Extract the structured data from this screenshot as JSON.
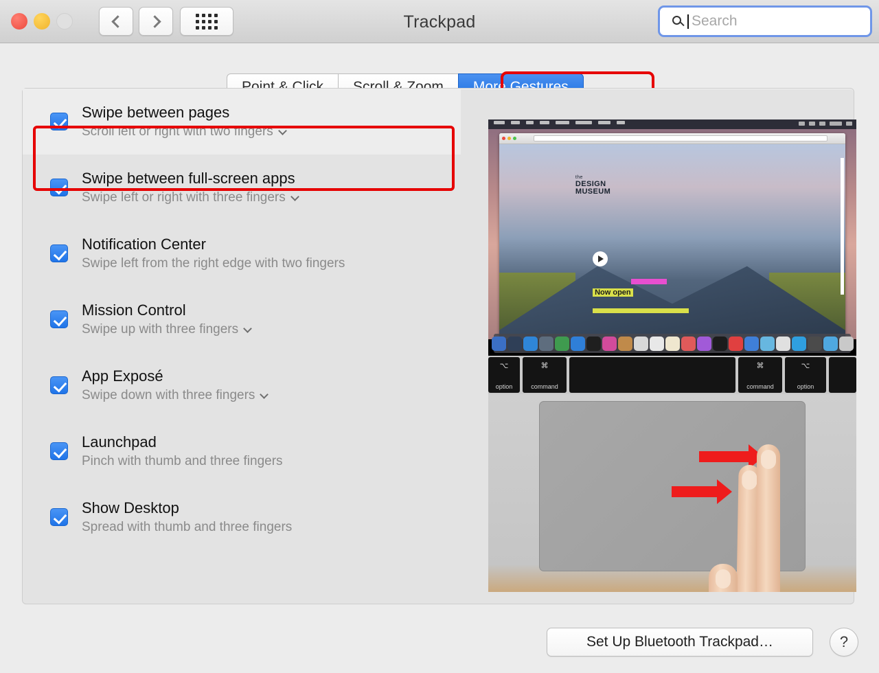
{
  "window": {
    "title": "Trackpad",
    "traffic_lights": [
      "close",
      "minimize",
      "zoom"
    ],
    "nav_back": "back-arrow",
    "nav_forward": "forward-arrow",
    "show_all": "grid-icon"
  },
  "search": {
    "placeholder": "Search",
    "value": "",
    "icon": "search-icon",
    "focused": true
  },
  "tabs": [
    {
      "label": "Point & Click",
      "selected": false
    },
    {
      "label": "Scroll & Zoom",
      "selected": false
    },
    {
      "label": "More Gestures",
      "selected": true
    }
  ],
  "gestures": [
    {
      "title": "Swipe between pages",
      "subtitle": "Scroll left or right with two fingers",
      "checked": true,
      "has_dropdown": true,
      "selected": true
    },
    {
      "title": "Swipe between full-screen apps",
      "subtitle": "Swipe left or right with three fingers",
      "checked": true,
      "has_dropdown": true,
      "selected": false
    },
    {
      "title": "Notification Center",
      "subtitle": "Swipe left from the right edge with two fingers",
      "checked": true,
      "has_dropdown": false,
      "selected": false
    },
    {
      "title": "Mission Control",
      "subtitle": "Swipe up with three fingers",
      "checked": true,
      "has_dropdown": true,
      "selected": false
    },
    {
      "title": "App Exposé",
      "subtitle": "Swipe down with three fingers",
      "checked": true,
      "has_dropdown": true,
      "selected": false
    },
    {
      "title": "Launchpad",
      "subtitle": "Pinch with thumb and three fingers",
      "checked": true,
      "has_dropdown": false,
      "selected": false
    },
    {
      "title": "Show Desktop",
      "subtitle": "Spread with thumb and three fingers",
      "checked": true,
      "has_dropdown": false,
      "selected": false
    }
  ],
  "preview": {
    "site_title_small": "the",
    "site_title_line1": "DESIGN",
    "site_title_line2": "MUSEUM",
    "banner_text": "Now open",
    "play_icon": "play-icon",
    "keys": [
      {
        "label": "option",
        "glyph": "⌥"
      },
      {
        "label": "command",
        "glyph": "⌘"
      },
      {
        "label": "",
        "glyph": ""
      },
      {
        "label": "command",
        "glyph": "⌘"
      },
      {
        "label": "option",
        "glyph": "⌥"
      },
      {
        "label": "",
        "glyph": ""
      }
    ],
    "dock_colors": [
      "#3b6fc4",
      "#2f3f57",
      "#2f86d8",
      "#5e6d7e",
      "#3f9b4f",
      "#2f7fd8",
      "#1f1f1f",
      "#d14b9b",
      "#c08a4a",
      "#d8d8d8",
      "#e8e8e8",
      "#efe7cf",
      "#e05a5a",
      "#a15ad8",
      "#1c1c1c",
      "#e04040",
      "#3f7fd8",
      "#67b7e0",
      "#e0e0e0",
      "#2f9fe0",
      "#4b4b4b",
      "#4fa8e0",
      "#c9c9c9"
    ],
    "arrows": [
      "arrow-right",
      "arrow-right"
    ]
  },
  "footer": {
    "bluetooth_button": "Set Up Bluetooth Trackpad…",
    "help_button": "?"
  },
  "colors": {
    "accent_blue": "#1f74e8",
    "annotation_red": "#e60000",
    "arrow_red": "#ee1c1c",
    "window_bg": "#ececec",
    "panel_bg": "#e3e3e3"
  }
}
